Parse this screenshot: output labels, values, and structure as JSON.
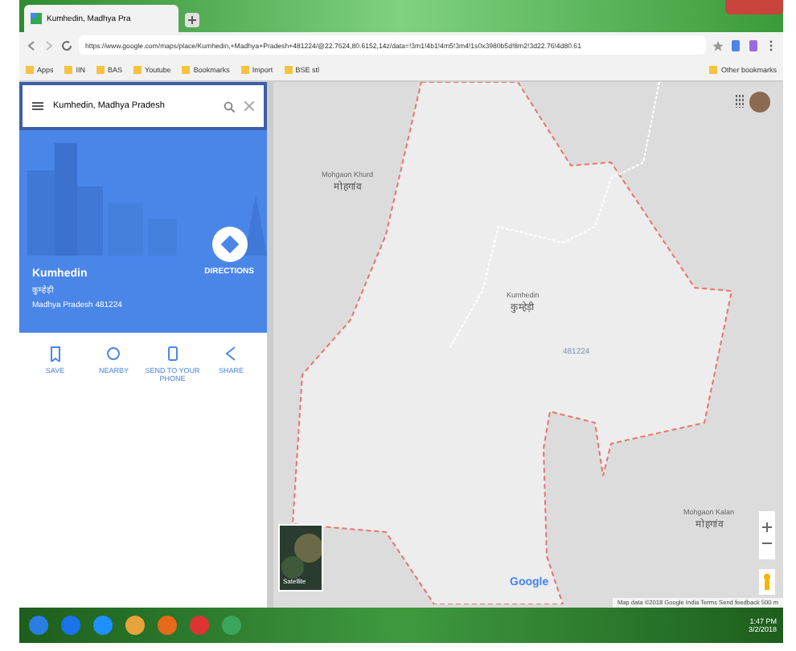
{
  "browser": {
    "tab_title": "Kumhedin, Madhya Pra",
    "address": "https://www.google.com/maps/place/Kumhedin,+Madhya+Pradesh+481224/@22.7624,80.6152,14z/data=!3m1!4b1!4m5!3m4!1s0x3980b5d!8m2!3d22.76!4d80.61",
    "bookmarks": [
      "Apps",
      "IIN",
      "BAS",
      "Youtube",
      "Bookmarks",
      "Import",
      "BSE stl"
    ],
    "other_bookmarks": "Other bookmarks"
  },
  "search": {
    "value": "Kumhedin, Madhya Pradesh"
  },
  "place": {
    "name": "Kumhedin",
    "local_name": "कुम्हेड़ी",
    "address": "Madhya Pradesh 481224",
    "directions": "DIRECTIONS"
  },
  "actions": [
    {
      "label": "SAVE"
    },
    {
      "label": "NEARBY"
    },
    {
      "label": "SEND TO YOUR PHONE"
    },
    {
      "label": "SHARE"
    }
  ],
  "map": {
    "labels": [
      {
        "name": "Mohgaon Khurd",
        "local": "मोहगांव"
      },
      {
        "name": "Kumhedin",
        "local": "कुम्हेड़ी"
      },
      {
        "name": "Mohgaon Kalan",
        "local": "मोहगांव"
      }
    ],
    "area_code": "481224",
    "satellite": "Satellite",
    "logo": "Google",
    "footer": "Map data ©2018 Google  India  Terms  Send feedback  500 m"
  },
  "taskbar": {
    "time": "1:47 PM",
    "date": "3/2/2018"
  }
}
